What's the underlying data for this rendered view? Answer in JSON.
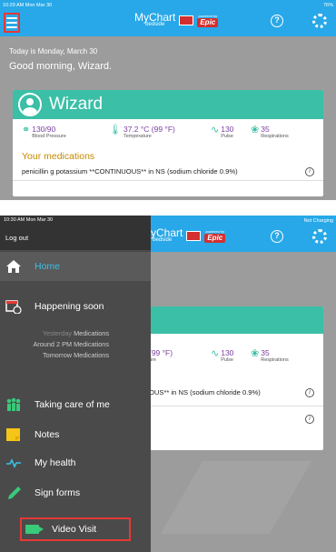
{
  "top": {
    "status": {
      "time": "10:29 AM  Mon Mar 30",
      "battery": "76%"
    },
    "app": {
      "brand": "MyChart",
      "brand_sub": "bedside",
      "powered": "powered by",
      "epic": "Epic"
    },
    "greeting": {
      "date_line": "Today is Monday, March 30",
      "hello": "Good morning, Wizard."
    },
    "patient": {
      "name": "Wizard",
      "vitals": [
        {
          "icon": "blood-pressure-icon",
          "value": "130/90",
          "label": "Blood Pressure"
        },
        {
          "icon": "thermometer-icon",
          "value": "37.2 °C (99 °F)",
          "label": "Temperature"
        },
        {
          "icon": "pulse-icon",
          "value": "130",
          "label": "Pulse"
        },
        {
          "icon": "lungs-icon",
          "value": "35",
          "label": "Respirations"
        }
      ],
      "medications_title": "Your medications",
      "medications": [
        "penicillin g potassium **CONTINUOUS** in NS (sodium chloride 0.9%)"
      ]
    }
  },
  "bottom": {
    "status": {
      "time": "10:30 AM  Mon Mar 30",
      "charging": "Not Charging"
    },
    "drawer": {
      "logout": "Log out",
      "items": {
        "home": "Home",
        "happening": "Happening soon",
        "care": "Taking care of me",
        "notes": "Notes",
        "health": "My health",
        "forms": "Sign forms",
        "video": "Video Visit"
      },
      "schedule": [
        {
          "when": "Yesterday",
          "what": "Medications"
        },
        {
          "when": "Around 2 PM",
          "what": "Medications"
        },
        {
          "when": "Tomorrow",
          "what": "Medications"
        }
      ]
    },
    "behind": {
      "temp_partial": "(99 °F)",
      "temp_lbl_partial": "ure",
      "pulse": "130",
      "pulse_lbl": "Pulse",
      "resp": "35",
      "resp_lbl": "Respirations",
      "med_partial": "OUS** in NS (sodium chloride 0.9%)"
    }
  },
  "colors": {
    "appbar": "#28a8e8",
    "accent": "#3bbfa7",
    "vital_value": "#7b3fa0",
    "med_title": "#c58a00",
    "highlight": "#e53935"
  }
}
